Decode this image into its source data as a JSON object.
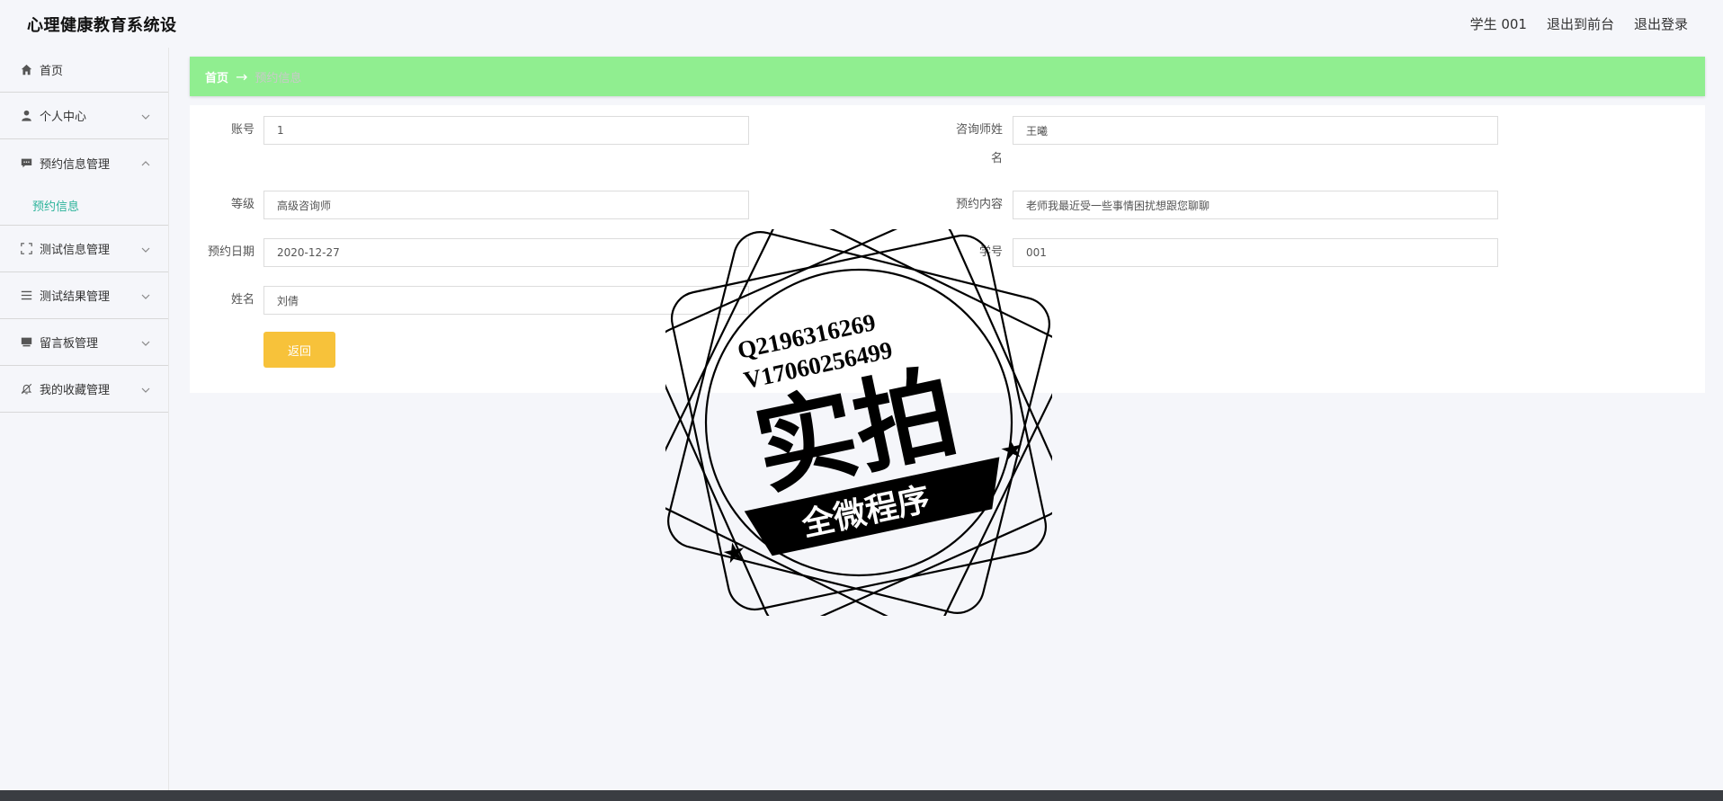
{
  "header": {
    "title": "心理健康教育系统设",
    "user": "学生 001",
    "front_link": "退出到前台",
    "logout": "退出登录"
  },
  "sidebar": {
    "items": [
      {
        "label": "首页",
        "icon": "home-icon"
      },
      {
        "label": "个人中心",
        "icon": "user-icon"
      },
      {
        "label": "预约信息管理",
        "icon": "message-icon",
        "sub": [
          "预约信息"
        ]
      },
      {
        "label": "测试信息管理",
        "icon": "fullscreen-icon"
      },
      {
        "label": "测试结果管理",
        "icon": "list-icon"
      },
      {
        "label": "留言板管理",
        "icon": "board-icon"
      },
      {
        "label": "我的收藏管理",
        "icon": "bell-off-icon"
      }
    ]
  },
  "breadcrumb": {
    "home": "首页",
    "separator": "→",
    "current": "预约信息"
  },
  "form": {
    "account_label": "账号",
    "account_value": "1",
    "counselor_label_1": "咨询师姓",
    "counselor_label_2": "名",
    "counselor_value": "王曦",
    "level_label": "等级",
    "level_value": "高级咨询师",
    "content_label": "预约内容",
    "content_value": "老师我最近受一些事情困扰想跟您聊聊",
    "date_label": "预约日期",
    "date_value": "2020-12-27",
    "student_no_label": "学号",
    "student_no_value": "001",
    "name_label": "姓名",
    "name_value": "刘倩",
    "back_button": "返回"
  },
  "watermark": {
    "line1": "Q2196316269",
    "line2": "V17060256499",
    "main": "实拍",
    "banner": "全微程序"
  },
  "colors": {
    "breadcrumb_bg": "#90ee90",
    "active_submenu": "#2cb39a",
    "button": "#f7c23a"
  }
}
